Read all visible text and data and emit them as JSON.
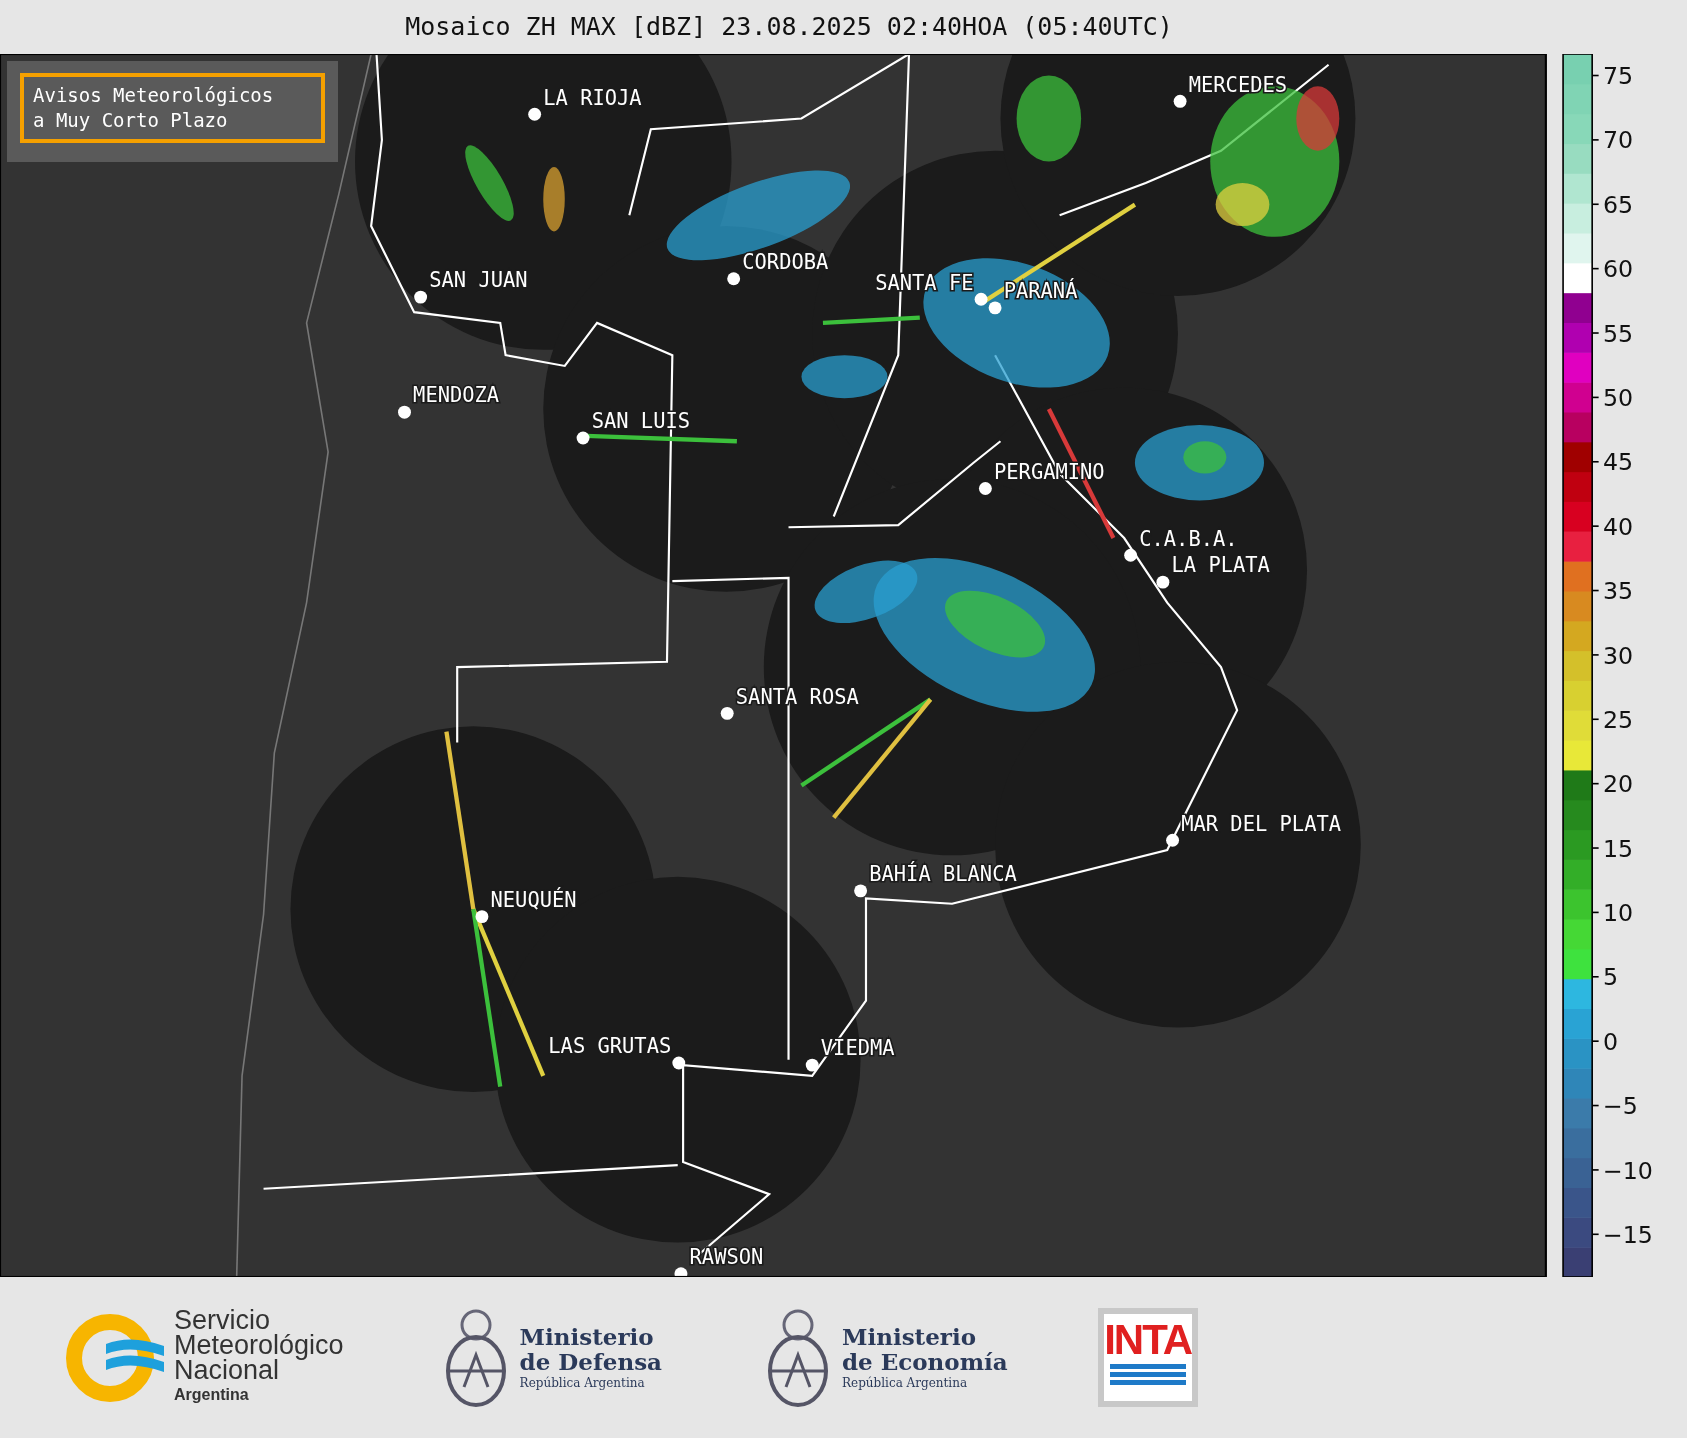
{
  "title": "Mosaico ZH MAX [dBZ] 23.08.2025 02:40HOA (05:40UTC)",
  "notice": {
    "lines": [
      "Avisos Meteorológicos",
      "a Muy Corto Plazo"
    ]
  },
  "cities": [
    {
      "name": "LA RIOJA"
    },
    {
      "name": "SAN JUAN"
    },
    {
      "name": "CORDOBA"
    },
    {
      "name": "SANTA FE"
    },
    {
      "name": "PARANÁ"
    },
    {
      "name": "MERCEDES"
    },
    {
      "name": "MENDOZA"
    },
    {
      "name": "SAN LUIS"
    },
    {
      "name": "PERGAMINO"
    },
    {
      "name": "C.A.B.A."
    },
    {
      "name": "LA PLATA"
    },
    {
      "name": "SANTA ROSA"
    },
    {
      "name": "MAR DEL PLATA"
    },
    {
      "name": "BAHÍA BLANCA"
    },
    {
      "name": "NEUQUÉN"
    },
    {
      "name": "LAS GRUTAS"
    },
    {
      "name": "VIEDMA"
    },
    {
      "name": "RAWSON"
    }
  ],
  "colorbar": {
    "ticks": [
      "75",
      "70",
      "65",
      "60",
      "55",
      "50",
      "45",
      "40",
      "35",
      "30",
      "25",
      "20",
      "15",
      "10",
      "5",
      "0",
      "−5",
      "−10",
      "−15"
    ]
  },
  "footer": {
    "smn": {
      "lines": [
        "Servicio",
        "Meteorológico",
        "Nacional"
      ],
      "country": "Argentina"
    },
    "ministries": [
      {
        "line1": "Ministerio",
        "line2": "de Defensa",
        "country": "República Argentina"
      },
      {
        "line1": "Ministerio",
        "line2": "de Economía",
        "country": "República Argentina"
      }
    ],
    "inta": "INTA"
  }
}
